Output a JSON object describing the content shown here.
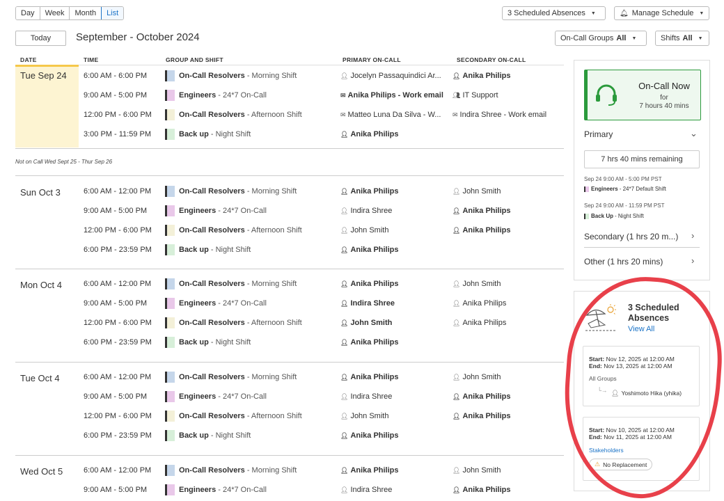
{
  "toolbar": {
    "views": [
      "Day",
      "Week",
      "Month",
      "List"
    ],
    "active_view": "List",
    "scheduled_absences_btn": "3 Scheduled Absences",
    "manage_schedule_btn": "Manage Schedule",
    "today_btn": "Today",
    "date_range": "September - October 2024",
    "oncall_groups_label": "On-Call Groups",
    "oncall_groups_value": "All",
    "shifts_label": "Shifts",
    "shifts_value": "All"
  },
  "table": {
    "headers": {
      "date": "DATE",
      "time": "TIME",
      "group_shift": "GROUP AND SHIFT",
      "primary": "PRIMARY ON-CALL",
      "secondary": "SECONDARY ON-CALL"
    },
    "not_on_call": "Not on Call  Wed Sept 25 -  Thur Sep 26",
    "days": [
      {
        "label": "Tue Sep 24",
        "rows": [
          {
            "time": "6:00 AM - 6:00 PM",
            "group": "On-Call Resolvers",
            "shift": " - Morning Shift",
            "primary": "Jocelyn Passaquindici Ar...",
            "secondary": "Anika Philips"
          },
          {
            "time": "9:00 AM - 5:00 PM",
            "group": "Engineers",
            "shift": " - 24*7 On-Call",
            "primary": "Anika Philips - Work email",
            "secondary": "IT Support"
          },
          {
            "time": "12:00 PM - 6:00 PM",
            "group": "On-Call Resolvers",
            "shift": " - Afternoon Shift",
            "primary": "Matteo Luna Da Silva - W...",
            "secondary": "Indira Shree - Work email"
          },
          {
            "time": "3:00 PM - 11:59 PM",
            "group": "Back up",
            "shift": " - Night Shift",
            "primary": "Anika Philips",
            "secondary": ""
          }
        ]
      },
      {
        "label": "Sun Oct 3",
        "rows": [
          {
            "time": "6:00 AM - 12:00 PM",
            "group": "On-Call Resolvers",
            "shift": " - Morning Shift",
            "primary": "Anika Philips",
            "secondary": "John Smith"
          },
          {
            "time": "9:00 AM - 5:00 PM",
            "group": "Engineers",
            "shift": " - 24*7 On-Call",
            "primary": "Indira Shree",
            "secondary": "Anika Philips"
          },
          {
            "time": "12:00 PM - 6:00 PM",
            "group": "On-Call Resolvers",
            "shift": " - Afternoon Shift",
            "primary": "John Smith",
            "secondary": "Anika Philips"
          },
          {
            "time": "6:00 PM - 23:59 PM",
            "group": "Back up",
            "shift": " - Night Shift",
            "primary": "Anika Philips",
            "secondary": ""
          }
        ]
      },
      {
        "label": "Mon Oct 4",
        "rows": [
          {
            "time": "6:00 AM - 12:00 PM",
            "group": "On-Call Resolvers",
            "shift": " - Morning Shift",
            "primary": "Anika Philips",
            "secondary": "John Smith"
          },
          {
            "time": "9:00 AM - 5:00 PM",
            "group": "Engineers",
            "shift": " - 24*7 On-Call",
            "primary": "Indira Shree",
            "secondary": "Anika Philips"
          },
          {
            "time": "12:00 PM - 6:00 PM",
            "group": "On-Call Resolvers",
            "shift": " - Afternoon Shift",
            "primary": "John Smith",
            "secondary": "Anika Philips"
          },
          {
            "time": "6:00 PM - 23:59 PM",
            "group": "Back up",
            "shift": " - Night Shift",
            "primary": "Anika Philips",
            "secondary": ""
          }
        ]
      },
      {
        "label": "Tue Oct 4",
        "rows": [
          {
            "time": "6:00 AM - 12:00 PM",
            "group": "On-Call Resolvers",
            "shift": " - Morning Shift",
            "primary": "Anika Philips",
            "secondary": "John Smith"
          },
          {
            "time": "9:00 AM - 5:00 PM",
            "group": "Engineers",
            "shift": " - 24*7 On-Call",
            "primary": "Indira Shree",
            "secondary": "Anika Philips"
          },
          {
            "time": "12:00 PM - 6:00 PM",
            "group": "On-Call Resolvers",
            "shift": " - Afternoon Shift",
            "primary": "John Smith",
            "secondary": "Anika Philips"
          },
          {
            "time": "6:00 PM - 23:59 PM",
            "group": "Back up",
            "shift": " - Night Shift",
            "primary": "Anika Philips",
            "secondary": ""
          }
        ]
      },
      {
        "label": "Wed Oct 5",
        "rows": [
          {
            "time": "6:00 AM - 12:00 PM",
            "group": "On-Call Resolvers",
            "shift": " - Morning Shift",
            "primary": "Anika Philips",
            "secondary": "John Smith"
          },
          {
            "time": "9:00 AM - 5:00 PM",
            "group": "Engineers",
            "shift": " - 24*7 On-Call",
            "primary": "Indira Shree",
            "secondary": "Anika Philips"
          }
        ]
      }
    ]
  },
  "oncall_panel": {
    "title": "On-Call Now",
    "for": "for",
    "duration": "7 hours 40 mins",
    "primary_label": "Primary",
    "remaining": "7 hrs 40 mins remaining",
    "entries": [
      {
        "time": "Sep 24 9:00 AM - 5:00 PM PST",
        "group": "Engineers",
        "shift": "- 24*7 Default Shift"
      },
      {
        "time": "Sep 24 9:00 AM - 11:59 PM PST",
        "group": "Back Up",
        "shift": "- Night Shift"
      }
    ],
    "secondary_label": "Secondary (1 hrs 20 m...)",
    "other_label": "Other (1 hrs 20 mins)"
  },
  "absences_panel": {
    "title": "3 Scheduled Absences",
    "view_all": "View All",
    "cards": [
      {
        "start_label": "Start:",
        "start": "Nov 12, 2025 at 12:00 AM",
        "end_label": "End:",
        "end": "Nov 13, 2025 at 12:00 AM",
        "group": "All Groups",
        "replacement": "Yoshimoto Hika (yhika)"
      },
      {
        "start_label": "Start:",
        "start": "Nov 10, 2025 at 12:00 AM",
        "end_label": "End:",
        "end": "Nov 11, 2025 at 12:00 AM",
        "group": "Stakeholders",
        "replacement": "No Replacement"
      }
    ]
  },
  "colors": {
    "accent": "#1a73c7",
    "oncall_green": "#2b9a3c",
    "today_bg": "#fdf4d2",
    "highlight": "#e8404a"
  }
}
